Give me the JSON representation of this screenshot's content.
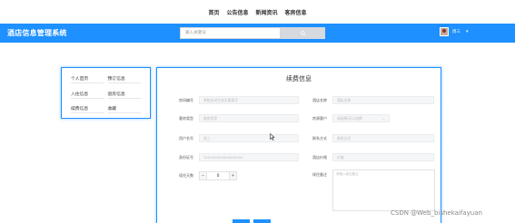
{
  "topnav": {
    "items": [
      "首页",
      "公告信息",
      "新闻资讯",
      "客房信息"
    ]
  },
  "header": {
    "brand": "酒店信息管理系统",
    "search_placeholder": "输入关键词",
    "user_name": "周三",
    "chevron": "▾",
    "accent_color": "#1e90ff"
  },
  "sidebar": {
    "items": [
      "个人首页",
      "预订信息",
      "入住信息",
      "退房信息",
      "续费信息",
      "收藏"
    ]
  },
  "form": {
    "title": "续费信息",
    "fields": {
      "room_number": {
        "label": "房间编号",
        "placeholder": "系统自动生成无需填写"
      },
      "room_name": {
        "label": "酒店名称",
        "placeholder": "酒店名称"
      },
      "guest_type": {
        "label": "客房类型",
        "placeholder": "客房类型"
      },
      "level": {
        "label": "房源客户",
        "placeholder": "请选择/可以选择"
      },
      "account": {
        "label": "用户名号",
        "placeholder": "张三"
      },
      "payment": {
        "label": "联系方式",
        "placeholder": "联系方式"
      },
      "id_number": {
        "label": "身份证号",
        "placeholder": "320000000000000000"
      },
      "phone": {
        "label": "酒店价格",
        "placeholder": "价格"
      },
      "days": {
        "label": "续住天数",
        "value": "0",
        "minus": "−",
        "plus": "+"
      },
      "remark": {
        "label": "续住备注",
        "placeholder": "请输入续住备注"
      }
    }
  },
  "watermark": "CSDN @Web_bishekaifayuan"
}
